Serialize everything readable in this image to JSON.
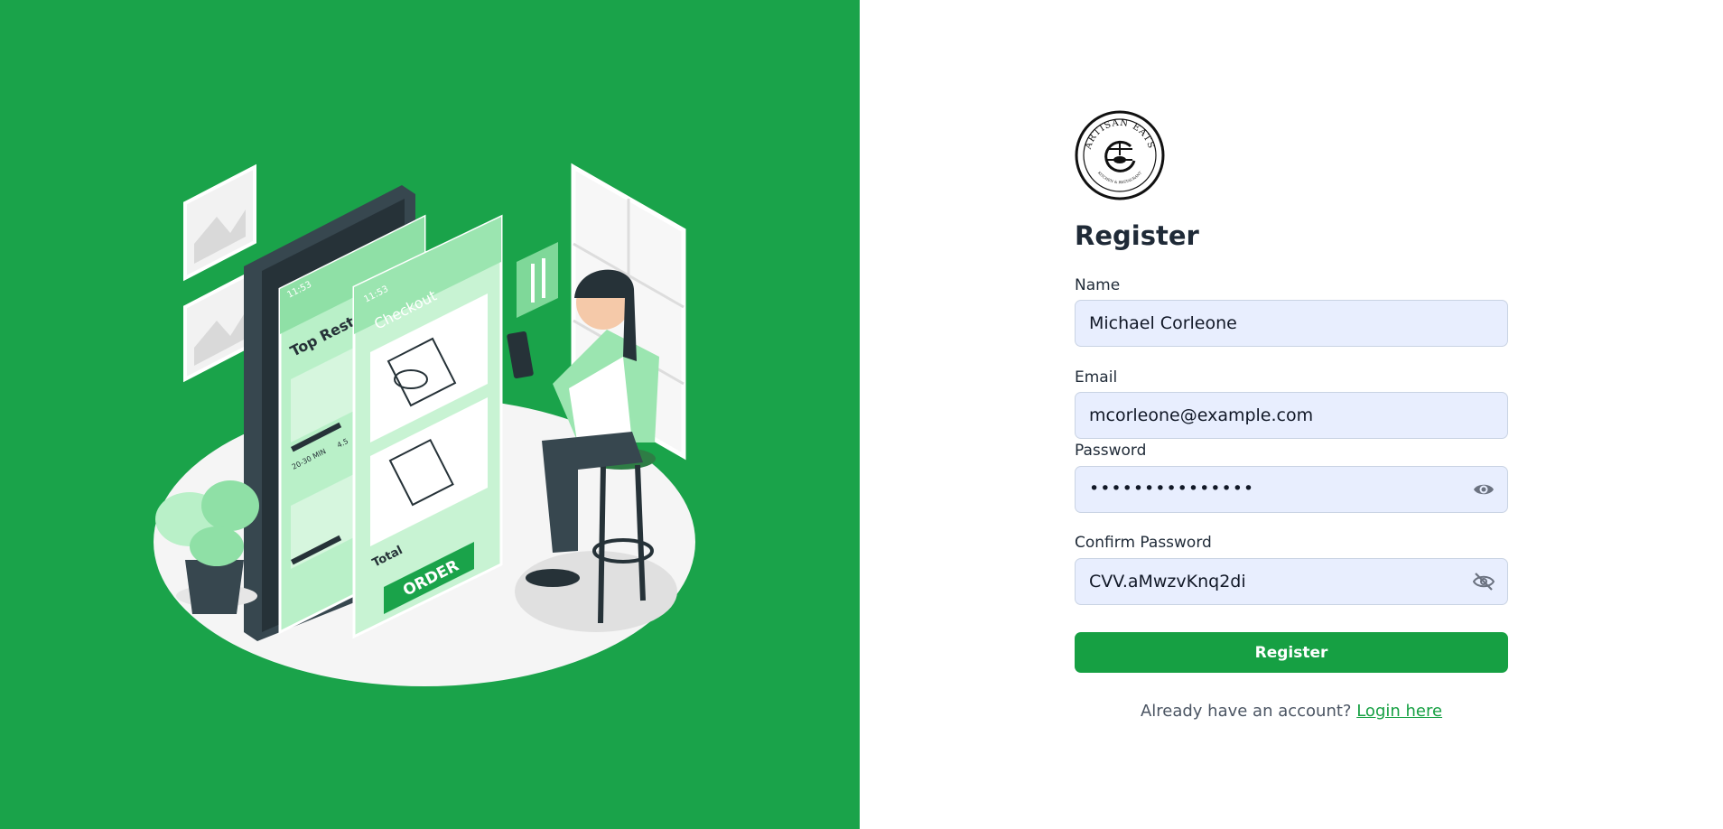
{
  "brand": {
    "logo_ring_text": "ARTISAN EATS",
    "logo_sub_text": "KITCHEN & RESTAURANT"
  },
  "illustration": {
    "left_screen_time": "11:53",
    "left_screen_title": "Top Restaurants",
    "left_badge_time": "20-30 MIN",
    "left_badge_rating": "4.5",
    "right_screen_time": "11:53",
    "right_screen_title": "Checkout",
    "price_tag": "$$$",
    "total_label": "Total",
    "order_label": "ORDER"
  },
  "form": {
    "title": "Register",
    "name_label": "Name",
    "name_value": "Michael Corleone",
    "email_label": "Email",
    "email_value": "mcorleone@example.com",
    "password_label": "Password",
    "password_value": "•••••••••••••••",
    "confirm_label": "Confirm Password",
    "confirm_value": "CVV.aMwzvKnq2di",
    "submit_label": "Register",
    "login_prompt": "Already have an account?",
    "login_link": "Login here"
  },
  "colors": {
    "brand_green": "#16a043",
    "panel_green": "#1aa34a",
    "field_bg": "#e8eefe"
  },
  "icons": {
    "password_toggle": "eye-icon",
    "confirm_toggle": "eye-off-icon"
  }
}
